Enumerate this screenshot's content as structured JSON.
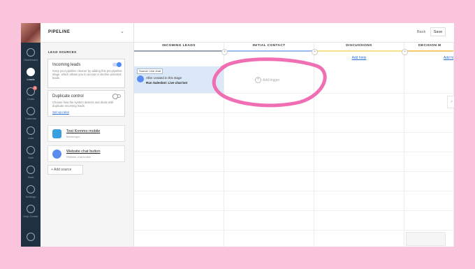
{
  "nav": {
    "items": [
      {
        "label": "Dashboard",
        "icon": "gauge-icon"
      },
      {
        "label": "Leads",
        "icon": "dollar-icon",
        "active": true
      },
      {
        "label": "Chats",
        "icon": "chat-icon",
        "badge": "4"
      },
      {
        "label": "Calendar",
        "icon": "check-icon"
      },
      {
        "label": "Lists",
        "icon": "list-icon"
      },
      {
        "label": "Mail",
        "icon": "mail-icon"
      },
      {
        "label": "Stats",
        "icon": "stats-icon"
      },
      {
        "label": "Settings",
        "icon": "gear-icon"
      },
      {
        "label": "Help Center",
        "icon": "help-icon"
      }
    ]
  },
  "panel": {
    "title": "PIPELINE",
    "section_label": "LEAD SOURCES",
    "incoming": {
      "title": "Incoming leads",
      "desc": "Keep your pipeline cleaner by adding this pre-pipeline stage, which allows you to accept or decline potential leads"
    },
    "duplicate": {
      "title": "Duplicate control",
      "desc": "Choose how the system detects and deals with duplicate incoming leads",
      "link": "Set up rules"
    },
    "sources": [
      {
        "name": "Test Kommo mobile",
        "sub": "Messenger",
        "icon": "telegram-icon"
      },
      {
        "name": "Website chat button",
        "sub": "Website chat button",
        "icon": "chat-button-icon"
      }
    ],
    "add_source": "Add source"
  },
  "board": {
    "back": "Back",
    "save": "Save",
    "columns": [
      {
        "title": "INCOMING LEADS",
        "color": "#9aa3ad",
        "hints": ""
      },
      {
        "title": "INITIAL CONTACT",
        "color": "#9bbcf0",
        "hints": ""
      },
      {
        "title": "DISCUSSIONS",
        "color": "#f5e28a",
        "hints": "Add hints"
      },
      {
        "title": "DECISION M",
        "color": "#f7c96a",
        "hints": "Add hi"
      }
    ],
    "trigger": {
      "tag": "Source: Live chat",
      "line1": "After created in this stage",
      "line2": "Run Salesbot: Live chat bot"
    },
    "add_trigger": "Add trigger"
  },
  "colors": {
    "background": "#fac4dd",
    "nav": "#1f3040",
    "highlight_circle": "#f06fb4"
  }
}
